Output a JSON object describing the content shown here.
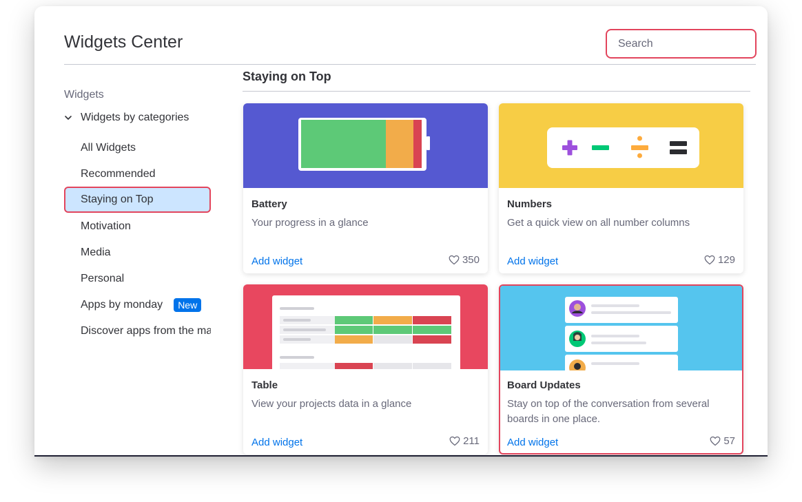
{
  "header": {
    "title": "Widgets Center",
    "search_placeholder": "Search"
  },
  "sidebar": {
    "heading": "Widgets",
    "category": "Widgets by categories",
    "items": [
      {
        "label": "All Widgets"
      },
      {
        "label": "Recommended"
      },
      {
        "label": "Staying on Top",
        "active": true
      },
      {
        "label": "Motivation"
      },
      {
        "label": "Media"
      },
      {
        "label": "Personal"
      },
      {
        "label": "Apps by monday",
        "badge": "New"
      },
      {
        "label": "Discover apps from the ma"
      }
    ]
  },
  "main": {
    "section_title": "Staying on Top",
    "cards": [
      {
        "name": "Battery",
        "description": "Your progress in a glance",
        "action": "Add widget",
        "likes": "350",
        "banner_color": "#5559d1"
      },
      {
        "name": "Numbers",
        "description": "Get a quick view on all number columns",
        "action": "Add widget",
        "likes": "129",
        "banner_color": "#f7cd45"
      },
      {
        "name": "Table",
        "description": "View your projects data in a glance",
        "action": "Add widget",
        "likes": "211",
        "banner_color": "#e8475f"
      },
      {
        "name": "Board Updates",
        "description": "Stay on top of the conversation from several boards in one place.",
        "action": "Add widget",
        "likes": "57",
        "banner_color": "#55c5ee"
      }
    ]
  },
  "colors": {
    "accent": "#0073ea",
    "highlight_border": "#e2445c",
    "active_bg": "#cce5ff",
    "battery_green": "#5dc977",
    "battery_orange": "#f2ac4a",
    "battery_red": "#d94452",
    "numbers_purple": "#9d50dd",
    "numbers_green": "#00c875",
    "numbers_orange": "#fdab3d"
  }
}
